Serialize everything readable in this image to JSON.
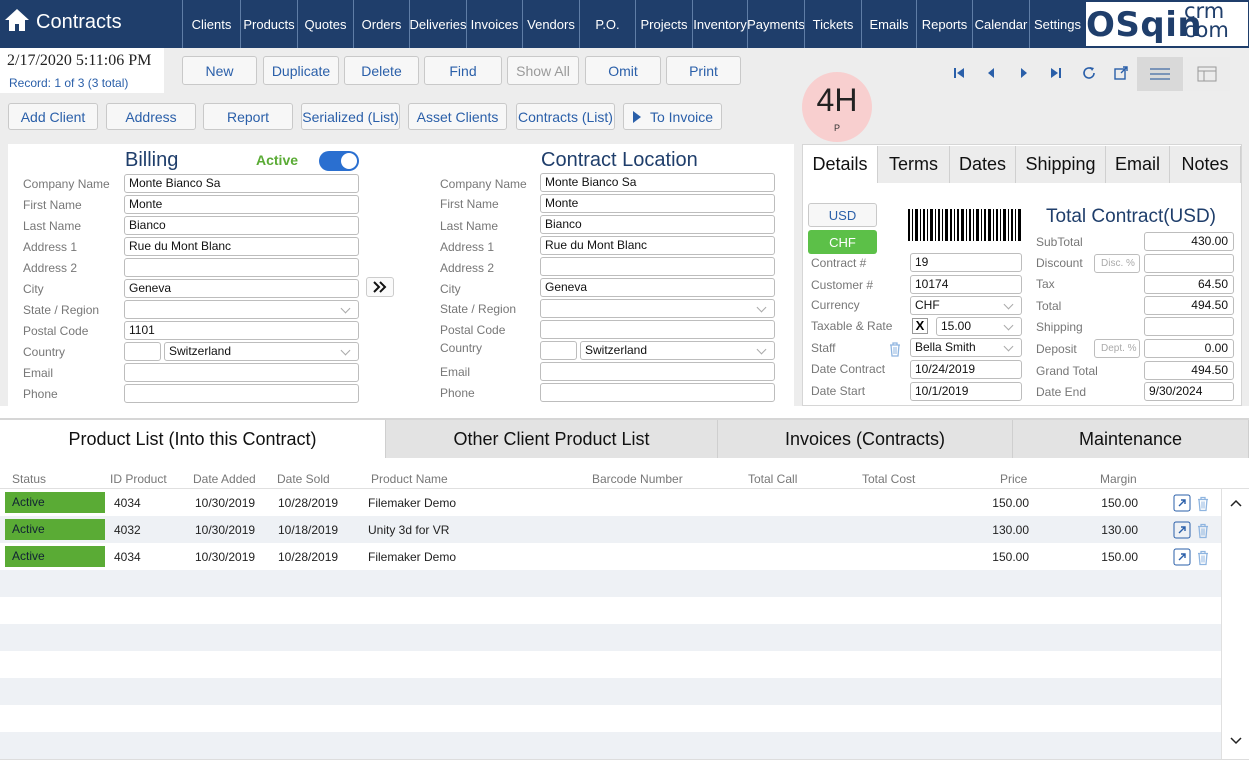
{
  "app": {
    "title": "Contracts"
  },
  "nav": {
    "items": [
      "Clients",
      "Products",
      "Quotes",
      "Orders",
      "Deliveries",
      "Invoices",
      "Vendors",
      "P.O.",
      "Projects",
      "Inventory",
      "Payments",
      "Tickets",
      "Emails",
      "Reports",
      "Calendar",
      "Settings"
    ]
  },
  "logo": {
    "main": "OSqin",
    "sup": "crm",
    "sub": "com"
  },
  "header": {
    "datetime": "2/17/2020 5:11:06 PM",
    "record": "Record:  1 of 3 (3 total)"
  },
  "toolbar": {
    "new": "New",
    "duplicate": "Duplicate",
    "delete": "Delete",
    "find": "Find",
    "show_all": "Show All",
    "omit": "Omit",
    "print": "Print"
  },
  "actions": {
    "add_client": "Add Client",
    "address": "Address",
    "report": "Report",
    "serialized": "Serialized (List)",
    "asset_clients": "Asset Clients",
    "contracts_list": "Contracts (List)",
    "to_invoice": "To Invoice"
  },
  "badge": {
    "main": "4H",
    "sub": "P"
  },
  "billing": {
    "title": "Billing",
    "status_label": "Active",
    "labels": {
      "company": "Company Name",
      "first": "First Name",
      "last": "Last Name",
      "address1": "Address 1",
      "address2": "Address 2",
      "city": "City",
      "state": "State / Region",
      "postal": "Postal Code",
      "country": "Country",
      "email": "Email",
      "phone": "Phone"
    },
    "values": {
      "company": "Monte Bianco Sa",
      "first": "Monte",
      "last": "Bianco",
      "address1": "Rue du Mont Blanc",
      "address2": "",
      "city": "Geneva",
      "state": "",
      "postal": "1101",
      "country_code": "",
      "country": "Switzerland",
      "email": "",
      "phone": ""
    }
  },
  "location": {
    "title": "Contract Location",
    "labels": {
      "company": "Company Name",
      "first": "First Name",
      "last": "Last Name",
      "address1": "Address 1",
      "address2": "Address 2",
      "city": "City",
      "state": "State / Region",
      "postal": "Postal Code",
      "country": "Country",
      "email": "Email",
      "phone": "Phone"
    },
    "values": {
      "company": "Monte Bianco Sa",
      "first": "Monte",
      "last": "Bianco",
      "address1": "Rue du Mont Blanc",
      "address2": "",
      "city": "Geneva",
      "state": "",
      "postal": "",
      "country_code": "",
      "country": "Switzerland",
      "email": "",
      "phone": ""
    }
  },
  "detail_tabs": [
    "Details",
    "Terms",
    "Dates",
    "Shipping",
    "Email",
    "Notes"
  ],
  "details": {
    "currency_usd": "USD",
    "currency_chf": "CHF",
    "total_title": "Total Contract(USD)",
    "labels": {
      "contract_no": "Contract #",
      "customer_no": "Customer #",
      "currency": "Currency",
      "taxable": "Taxable & Rate",
      "staff": "Staff",
      "date_contract": "Date Contract",
      "date_start": "Date Start"
    },
    "values": {
      "contract_no": "19",
      "customer_no": "10174",
      "currency": "CHF",
      "taxable_mark": "X",
      "rate": "15.00",
      "staff": "Bella Smith",
      "date_contract": "10/24/2019",
      "date_start": "10/1/2019"
    },
    "totals_labels": {
      "subtotal": "SubTotal",
      "discount": "Discount",
      "tax": "Tax",
      "total": "Total",
      "shipping": "Shipping",
      "deposit": "Deposit",
      "grand_total": "Grand Total",
      "date_end": "Date End"
    },
    "totals": {
      "subtotal": "430.00",
      "discount_placeholder": "Disc. %",
      "discount": "",
      "tax": "64.50",
      "total": "494.50",
      "shipping": "",
      "deposit_placeholder": "Dept. %",
      "deposit": "0.00",
      "grand_total": "494.50",
      "date_end": "9/30/2024"
    }
  },
  "list_tabs": [
    "Product List (Into this Contract)",
    "Other Client Product List",
    "Invoices (Contracts)",
    "Maintenance"
  ],
  "table": {
    "headers": [
      "Status",
      "ID Product",
      "Date Added",
      "Date Sold",
      "Product Name",
      "Barcode Number",
      "Total Call",
      "Total Cost",
      "Price",
      "Margin"
    ],
    "rows": [
      {
        "status": "Active",
        "id": "4034",
        "added": "10/30/2019",
        "sold": "10/28/2019",
        "name": "Filemaker Demo",
        "barcode": "",
        "call": "",
        "cost": "",
        "price": "150.00",
        "margin": "150.00"
      },
      {
        "status": "Active",
        "id": "4032",
        "added": "10/30/2019",
        "sold": "10/18/2019",
        "name": "Unity 3d for VR",
        "barcode": "",
        "call": "",
        "cost": "",
        "price": "130.00",
        "margin": "130.00"
      },
      {
        "status": "Active",
        "id": "4034",
        "added": "10/30/2019",
        "sold": "10/28/2019",
        "name": "Filemaker Demo",
        "barcode": "",
        "call": "",
        "cost": "",
        "price": "150.00",
        "margin": "150.00"
      }
    ]
  },
  "colors": {
    "brand": "#1f3e6b",
    "accent": "#2a5fa9",
    "active": "#5aab35",
    "badge": "#f8cfcf"
  }
}
